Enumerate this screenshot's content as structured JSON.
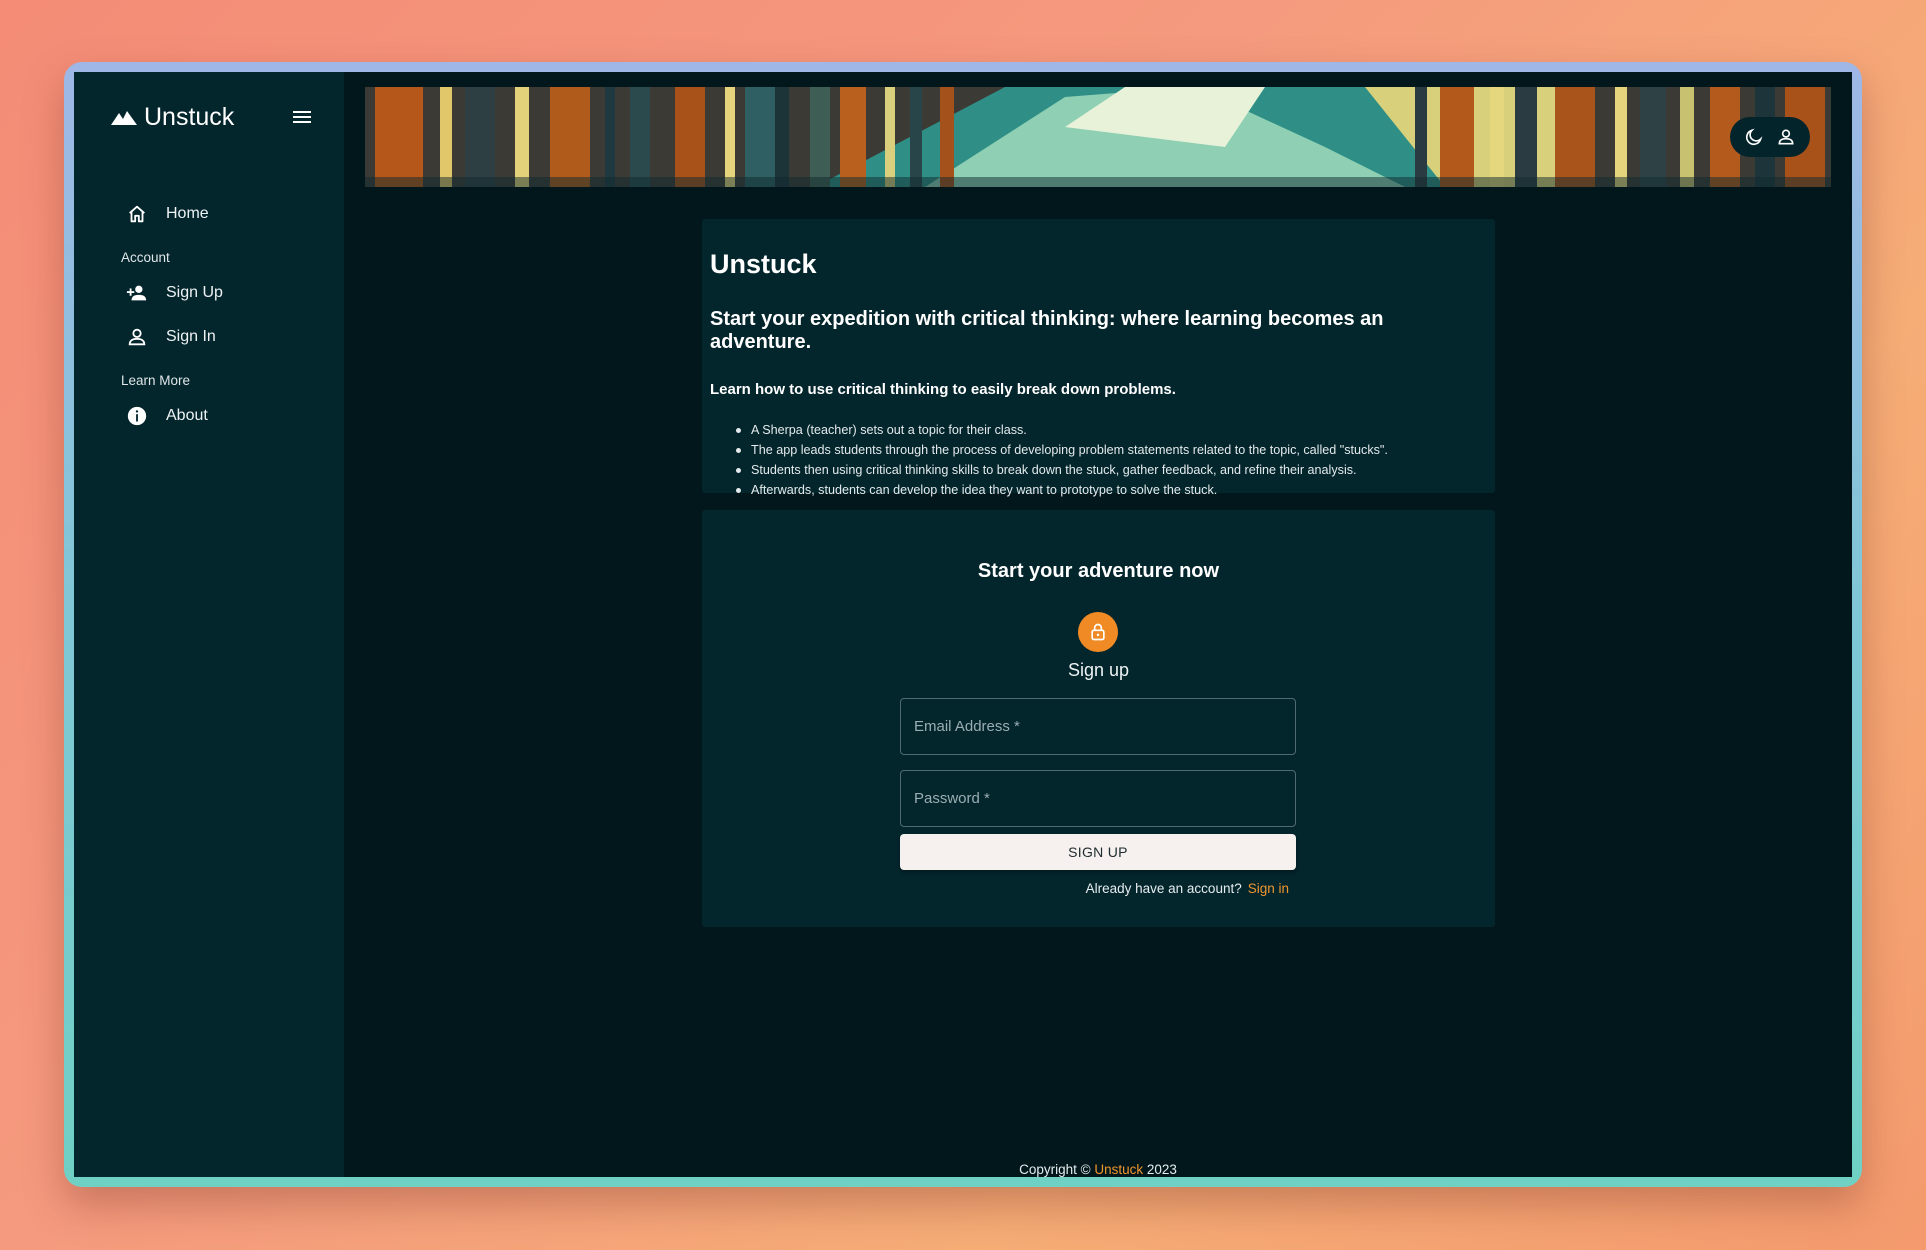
{
  "sidebar": {
    "brand": "Unstuck",
    "items": {
      "home": "Home",
      "sign_up": "Sign Up",
      "sign_in": "Sign In",
      "about": "About"
    },
    "sections": {
      "account": "Account",
      "learn_more": "Learn More"
    }
  },
  "header": {
    "icons": [
      "moon-icon",
      "user-icon"
    ]
  },
  "intro": {
    "title": "Unstuck",
    "tagline": "Start your expedition with critical thinking: where learning becomes an adventure.",
    "subtitle": "Learn how to use critical thinking to easily break down problems.",
    "bullets": [
      "A Sherpa (teacher) sets out a topic for their class.",
      "The app leads students through the process of developing problem statements related to the topic, called \"stucks\".",
      "Students then using critical thinking skills to break down the stuck, gather feedback, and refine their analysis.",
      "Afterwards, students can develop the idea they want to prototype to solve the stuck."
    ]
  },
  "signup": {
    "title": "Start your adventure now",
    "subtitle": "Sign up",
    "email_placeholder": "Email Address *",
    "password_placeholder": "Password *",
    "button": "SIGN UP",
    "already_text": "Already have an account?",
    "sign_in_link": "Sign in"
  },
  "footer": {
    "prefix": "Copyright ©",
    "brand": "Unstuck",
    "year": "2023"
  },
  "colors": {
    "accent": "#f08a24",
    "sidebar_bg": "#03252c",
    "main_bg": "#02171c",
    "card_bg": "#03252c"
  }
}
